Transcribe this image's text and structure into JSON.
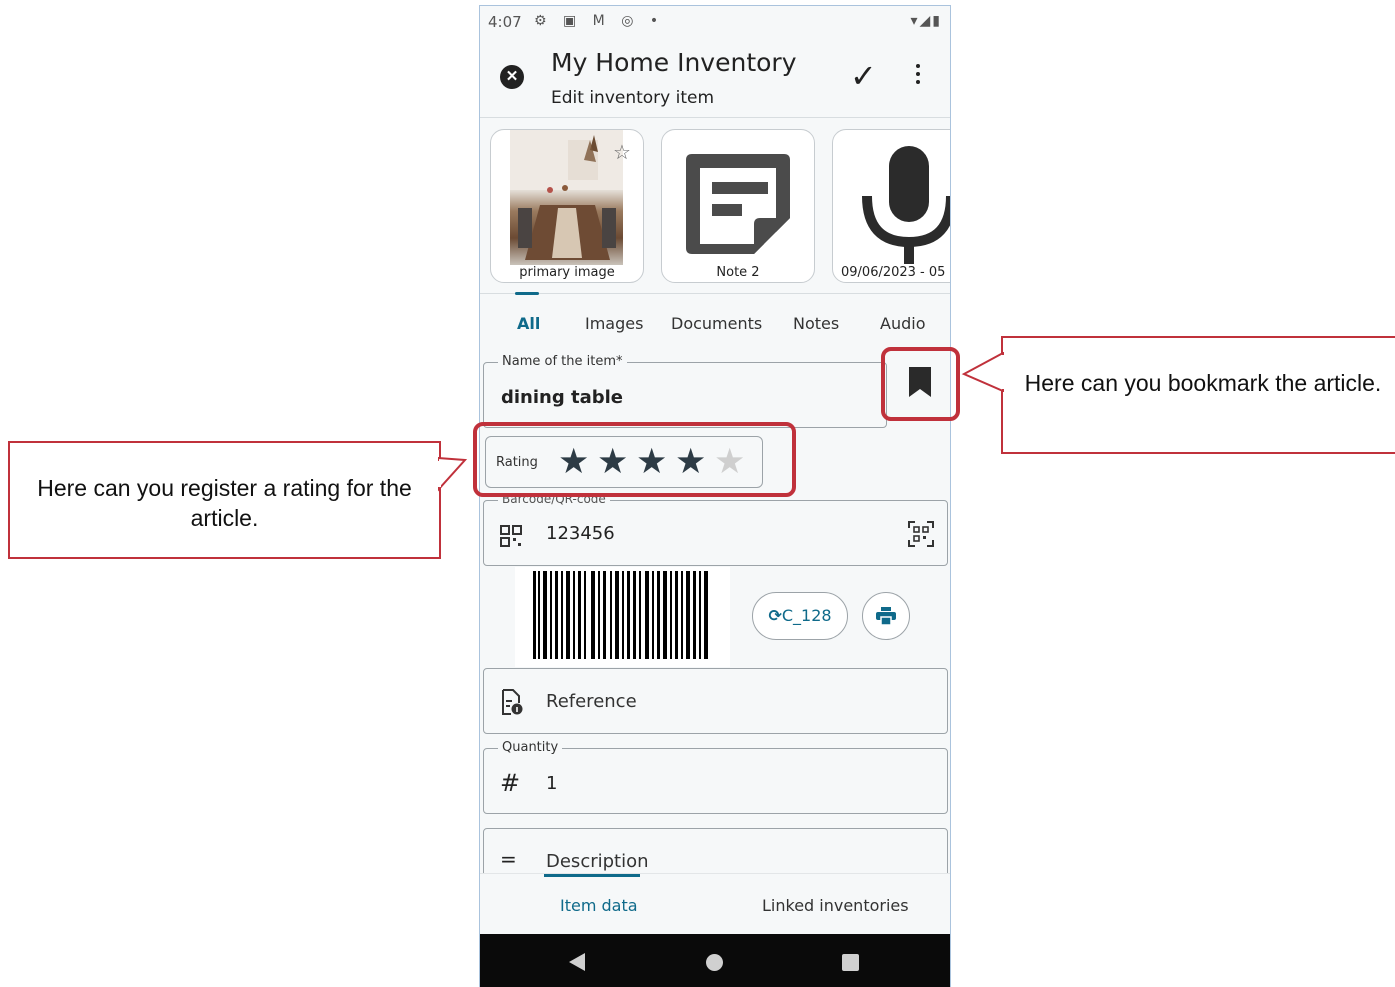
{
  "status_bar": {
    "time": "4:07",
    "left_icons": "⚙ ▣ M ◎ •",
    "right_icons": "▾◢▮"
  },
  "app_bar": {
    "title": "My Home Inventory",
    "subtitle": "Edit inventory item"
  },
  "attachments": [
    {
      "caption": "primary image"
    },
    {
      "caption": "Note 2"
    },
    {
      "caption": "09/06/2023 - 05"
    }
  ],
  "tabs": [
    "All",
    "Images",
    "Documents",
    "Notes",
    "Audio"
  ],
  "name_field": {
    "label": "Name of the item*",
    "value": "dining table"
  },
  "rating": {
    "label": "Rating",
    "value": 4,
    "max": 5
  },
  "barcode_field": {
    "label": "Barcode/QR-code",
    "value": "123456"
  },
  "barcode_format_button": "C_128",
  "reference_field": {
    "placeholder": "Reference"
  },
  "quantity_field": {
    "label": "Quantity",
    "value": "1"
  },
  "description_field": {
    "placeholder": "Description"
  },
  "bottom_nav": {
    "item_data": "Item data",
    "linked": "Linked inventories"
  },
  "callouts": {
    "rating": "Here can you register a rating for the article.",
    "bookmark": "Here can you bookmark the article."
  },
  "colors": {
    "accent": "#0f6a8a",
    "callout_border": "#c0313b",
    "star_filled": "#2d3b45",
    "star_empty": "#cfcfcf"
  }
}
